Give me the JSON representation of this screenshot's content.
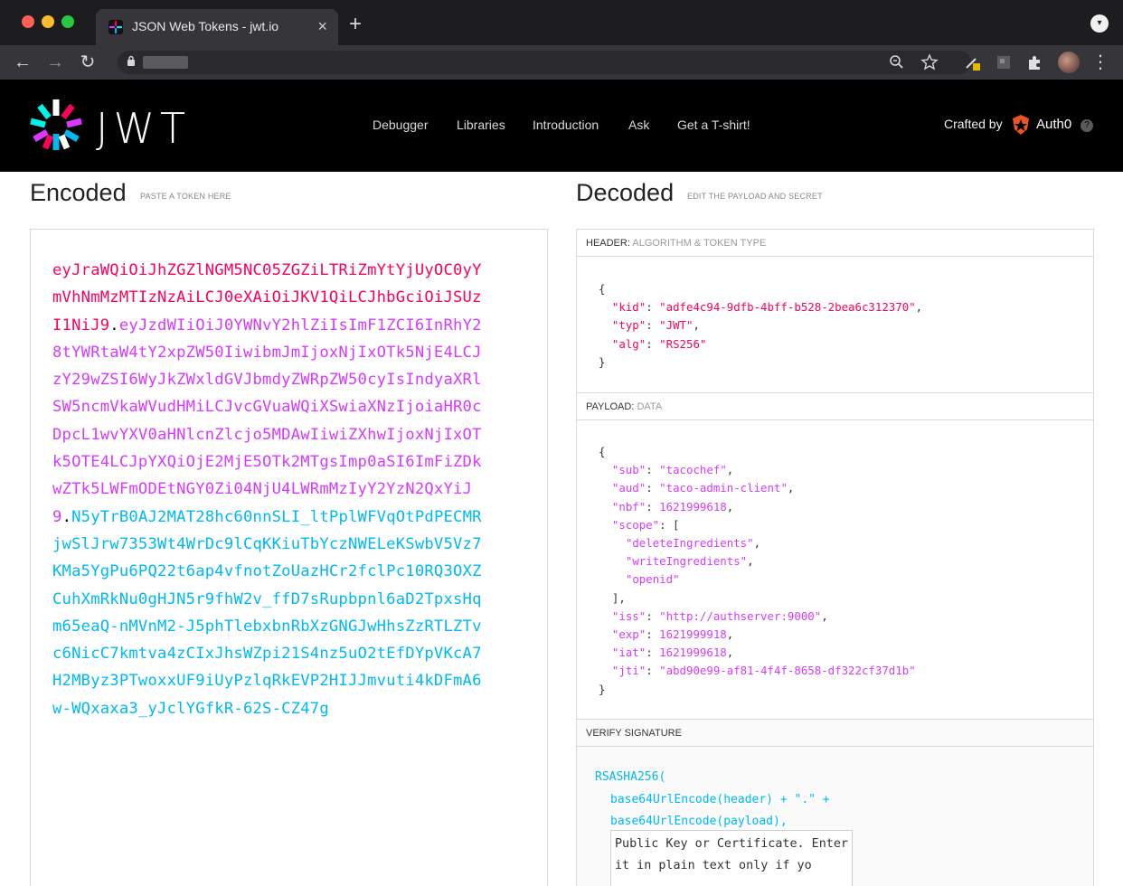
{
  "browser": {
    "tab_title": "JSON Web Tokens - jwt.io",
    "tab_close": "×",
    "new_tab": "+",
    "back": "←",
    "forward": "→",
    "reload": "↻",
    "lock": "🔒"
  },
  "site": {
    "logo_text": "JWT",
    "nav": [
      "Debugger",
      "Libraries",
      "Introduction",
      "Ask",
      "Get a T-shirt!"
    ],
    "crafted_by": "Crafted by",
    "auth0": "Auth0"
  },
  "encoded": {
    "title": "Encoded",
    "subtitle": "PASTE A TOKEN HERE",
    "header_part": "eyJraWQiOiJhZGZlNGM5NC05ZGZiLTRiZmYtYjUyOC0yYmVhNmMzMTIzNzAiLCJ0eXAiOiJKV1QiLCJhbGciOiJSUzI1NiJ9",
    "payload_part": "eyJzdWIiOiJ0YWNvY2hlZiIsImF1ZCI6InRhY28tYWRtaW4tY2xpZW50IiwibmJmIjoxNjIxOTk5NjE4LCJzY29wZSI6WyJkZWxldGVJbmdyZWRpZW50cyIsIndyaXRlSW5ncmVkaWVudHMiLCJvcGVuaWQiXSwiaXNzIjoiaHR0cDpcL1wvYXV0aHNlcnZlcjo5MDAwIiwiZXhwIjoxNjIxOTk5OTE4LCJpYXQiOjE2MjE5OTk2MTgsImp0aSI6ImFiZDkwZTk5LWFmODEtNGY0Zi04NjU4LWRmMzIyY2YzN2QxYiJ9",
    "signature_part": "N5yTrB0AJ2MAT28hc60nnSLI_ltPplWFVqOtPdPECMRjwSlJrw7353Wt4WrDc9lCqKKiuTbYczNWELeKSwbV5Vz7KMa5YgPu6PQ22t6ap4vfnotZoUazHCr2fclPc10RQ3OXZCuhXmRkNu0gHJN5r9fhW2v_ffD7sRupbpnl6aD2TpxsHqm65eaQ-nMVnM2-J5phTlebxbnRbXzGNGJwHhsZzRTLZTvc6NicC7kmtva4zCIxJhsWZpi21S4nz5uO2tEfDYpVKcA7H2MByz3PTwoxxUF9iUyPzlqRkEVP2HIJJmvuti4kDFmA6w-WQxaxa3_yJclYGfkR-62S-CZ47g"
  },
  "decoded": {
    "title": "Decoded",
    "subtitle": "EDIT THE PAYLOAD AND SECRET",
    "header_label": "HEADER:",
    "header_desc": "ALGORITHM & TOKEN TYPE",
    "header": {
      "kid": "adfe4c94-9dfb-4bff-b528-2bea6c312370",
      "typ": "JWT",
      "alg": "RS256"
    },
    "payload_label": "PAYLOAD:",
    "payload_desc": "DATA",
    "payload": {
      "sub": "tacochef",
      "aud": "taco-admin-client",
      "nbf": "1621999618",
      "scope": [
        "deleteIngredients",
        "writeIngredients",
        "openid"
      ],
      "iss": "http://authserver:9000",
      "exp": "1621999918",
      "iat": "1621999618",
      "jti": "abd90e99-af81-4f4f-8658-df322cf37d1b"
    },
    "verify_label": "VERIFY SIGNATURE",
    "verify_fn": "RSASHA256(",
    "verify_line1": "base64UrlEncode(header) + \".\" +",
    "verify_line2": "base64UrlEncode(payload),",
    "key_placeholder": "Public Key or Certificate. Enter it in plain text only if yo"
  },
  "colors": {
    "header": "#fb015b",
    "payload": "#d63aff",
    "signature": "#00b9f1"
  }
}
